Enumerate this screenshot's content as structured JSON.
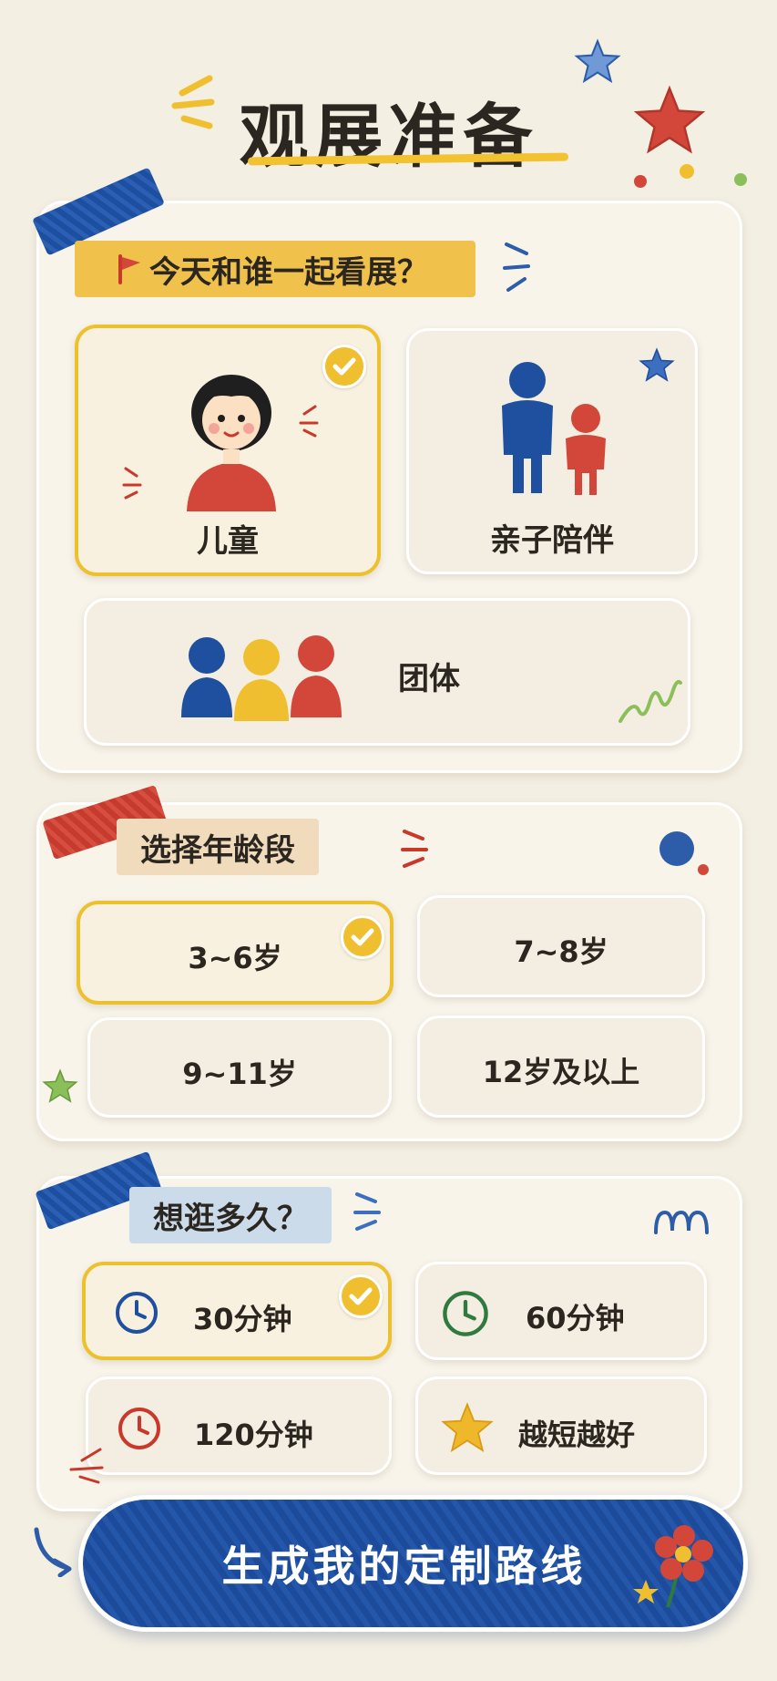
{
  "header": {
    "title": "观展准备"
  },
  "companion": {
    "label": "今天和谁一起看展？",
    "options": [
      {
        "label": "儿童",
        "selected": true,
        "icon": "child-icon"
      },
      {
        "label": "亲子陪伴",
        "selected": false,
        "icon": "parent-child-icon"
      },
      {
        "label": "团体",
        "selected": false,
        "icon": "group-icon"
      }
    ]
  },
  "age": {
    "label": "选择年龄段",
    "options": [
      {
        "label": "3~6岁",
        "selected": true
      },
      {
        "label": "7~8岁",
        "selected": false
      },
      {
        "label": "9~11岁",
        "selected": false
      },
      {
        "label": "12岁及以上",
        "selected": false
      }
    ]
  },
  "duration": {
    "label": "想逛多久？",
    "options": [
      {
        "label": "30分钟",
        "selected": true,
        "icon": "clock-icon",
        "color": "#1f4f9f"
      },
      {
        "label": "60分钟",
        "selected": false,
        "icon": "clock-icon",
        "color": "#2f7a3e"
      },
      {
        "label": "120分钟",
        "selected": false,
        "icon": "clock-icon",
        "color": "#c8392b"
      },
      {
        "label": "越短越好",
        "selected": false,
        "icon": "star-icon",
        "color": "#efb82a"
      }
    ]
  },
  "cta": {
    "label": "生成我的定制路线"
  },
  "colors": {
    "background": "#f4efe3",
    "accent_yellow": "#f0bf2f",
    "accent_blue": "#1f4f9f",
    "accent_red": "#c8392b",
    "accent_green": "#2f7a3e"
  }
}
